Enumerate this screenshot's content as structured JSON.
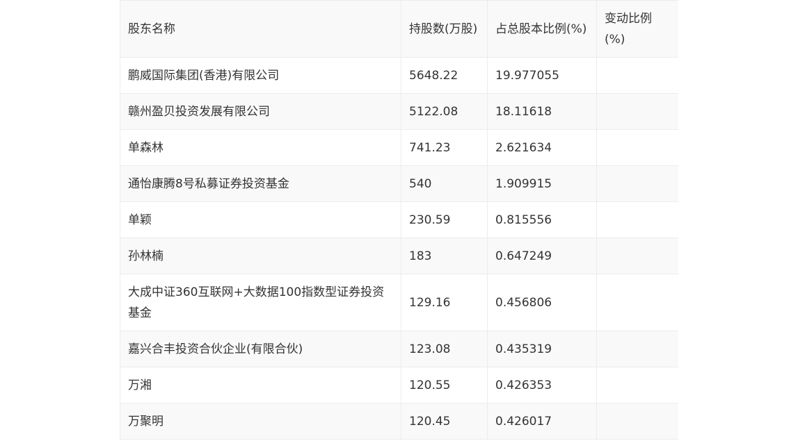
{
  "table": {
    "headers": [
      "股东名称",
      "持股数(万股)",
      "占总股本比例(%)",
      "变动比例(%)"
    ],
    "rows": [
      {
        "name": "鹏威国际集团(香港)有限公司",
        "shares": "5648.22",
        "ratio": "19.977055",
        "change": ""
      },
      {
        "name": "赣州盈贝投资发展有限公司",
        "shares": "5122.08",
        "ratio": "18.11618",
        "change": ""
      },
      {
        "name": "单森林",
        "shares": "741.23",
        "ratio": "2.621634",
        "change": ""
      },
      {
        "name": "通怡康腾8号私募证券投资基金",
        "shares": "540",
        "ratio": "1.909915",
        "change": ""
      },
      {
        "name": "单颖",
        "shares": "230.59",
        "ratio": "0.815556",
        "change": ""
      },
      {
        "name": "孙林楠",
        "shares": "183",
        "ratio": "0.647249",
        "change": ""
      },
      {
        "name": "大成中证360互联网+大数据100指数型证券投资基金",
        "shares": "129.16",
        "ratio": "0.456806",
        "change": ""
      },
      {
        "name": "嘉兴合丰投资合伙企业(有限合伙)",
        "shares": "123.08",
        "ratio": "0.435319",
        "change": ""
      },
      {
        "name": "万湘",
        "shares": "120.55",
        "ratio": "0.426353",
        "change": ""
      },
      {
        "name": "万聚明",
        "shares": "120.45",
        "ratio": "0.426017",
        "change": ""
      }
    ]
  }
}
